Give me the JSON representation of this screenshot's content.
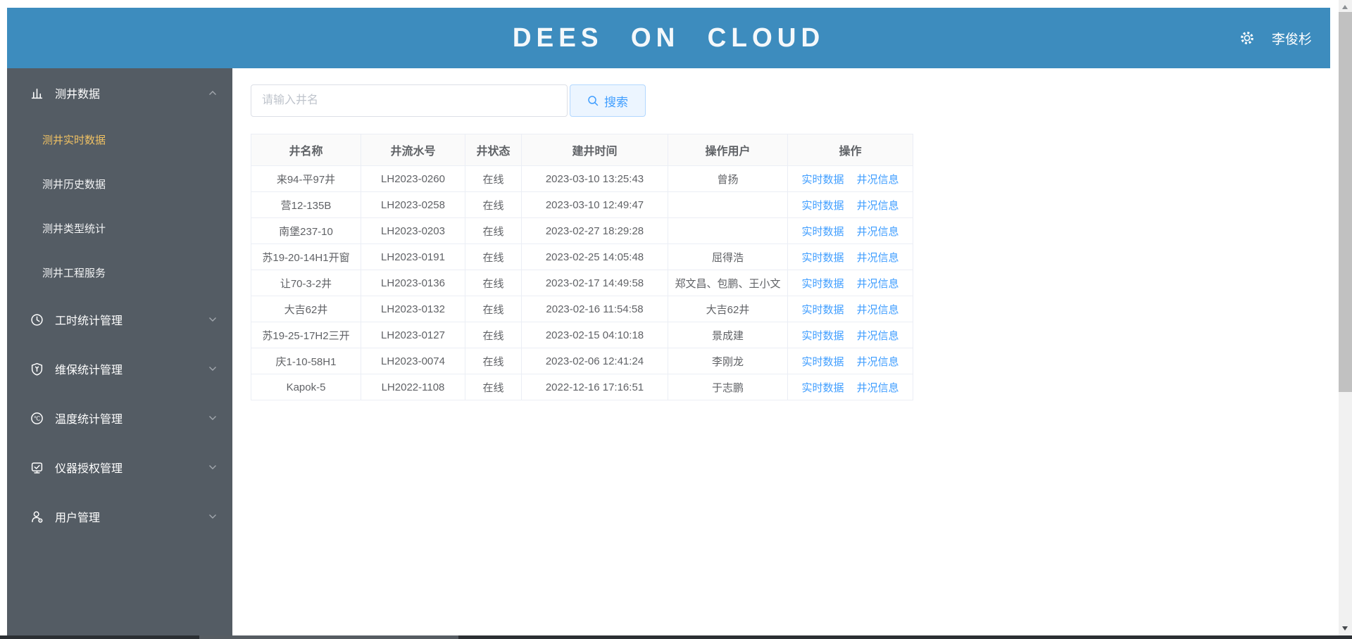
{
  "header": {
    "title": "DEES ON CLOUD",
    "user_name": "李俊杉",
    "settings_icon": "gear-icon"
  },
  "sidebar": {
    "menu": [
      {
        "label": "测井数据",
        "icon": "bar-chart-icon",
        "expanded": true,
        "children": [
          {
            "label": "测井实时数据",
            "active": true
          },
          {
            "label": "测井历史数据",
            "active": false
          },
          {
            "label": "测井类型统计",
            "active": false
          },
          {
            "label": "测井工程服务",
            "active": false
          }
        ]
      },
      {
        "label": "工时统计管理",
        "icon": "clock-icon",
        "expanded": false
      },
      {
        "label": "维保统计管理",
        "icon": "shield-wrench-icon",
        "expanded": false
      },
      {
        "label": "温度统计管理",
        "icon": "temperature-icon",
        "expanded": false
      },
      {
        "label": "仪器授权管理",
        "icon": "device-check-icon",
        "expanded": false
      },
      {
        "label": "用户管理",
        "icon": "user-gear-icon",
        "expanded": false
      }
    ]
  },
  "search": {
    "placeholder": "请输入井名",
    "button_label": "搜索",
    "button_icon": "magnifier-icon"
  },
  "table": {
    "columns": [
      "井名称",
      "井流水号",
      "井状态",
      "建井时间",
      "操作用户",
      "操作"
    ],
    "action_labels": [
      "实时数据",
      "井况信息"
    ],
    "rows": [
      {
        "name": "来94-平97井",
        "serial": "LH2023-0260",
        "status": "在线",
        "created": "2023-03-10 13:25:43",
        "operator": "曾扬"
      },
      {
        "name": "营12-135B",
        "serial": "LH2023-0258",
        "status": "在线",
        "created": "2023-03-10 12:49:47",
        "operator": ""
      },
      {
        "name": "南堡237-10",
        "serial": "LH2023-0203",
        "status": "在线",
        "created": "2023-02-27 18:29:28",
        "operator": ""
      },
      {
        "name": "苏19-20-14H1开窗",
        "serial": "LH2023-0191",
        "status": "在线",
        "created": "2023-02-25 14:05:48",
        "operator": "屈得浩"
      },
      {
        "name": "让70-3-2井",
        "serial": "LH2023-0136",
        "status": "在线",
        "created": "2023-02-17 14:49:58",
        "operator": "郑文昌、包鹏、王小文"
      },
      {
        "name": "大吉62井",
        "serial": "LH2023-0132",
        "status": "在线",
        "created": "2023-02-16 11:54:58",
        "operator": "大吉62井"
      },
      {
        "name": "苏19-25-17H2三开",
        "serial": "LH2023-0127",
        "status": "在线",
        "created": "2023-02-15 04:10:18",
        "operator": "景成建"
      },
      {
        "name": "庆1-10-58H1",
        "serial": "LH2023-0074",
        "status": "在线",
        "created": "2023-02-06 12:41:24",
        "operator": "李刚龙"
      },
      {
        "name": "Kapok-5",
        "serial": "LH2022-1108",
        "status": "在线",
        "created": "2022-12-16 17:16:51",
        "operator": "于志鹏"
      }
    ]
  },
  "colors": {
    "header_bg": "#3d8cbe",
    "sidebar_bg": "#545c64",
    "active_menu_item": "#efc163",
    "link": "#409eff",
    "button_bg": "#ecf5ff",
    "button_border": "#b3d8ff",
    "table_border": "#ebeef5"
  }
}
